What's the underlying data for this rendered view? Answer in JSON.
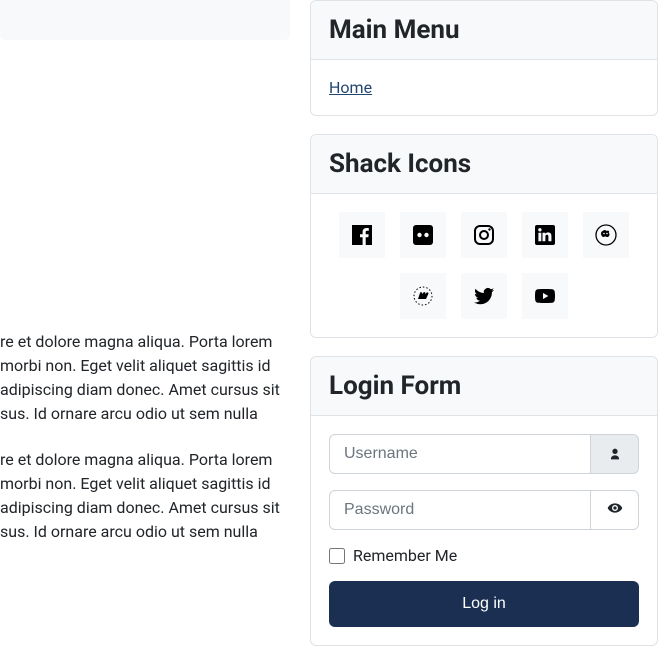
{
  "article": {
    "p1": "re et dolore magna aliqua. Porta lorem morbi non. Eget velit aliquet sagittis id adipiscing diam donec. Amet cursus sit sus. Id ornare arcu odio ut sem nulla",
    "p2": "re et dolore magna aliqua. Porta lorem morbi non. Eget velit aliquet sagittis id adipiscing diam donec. Amet cursus sit sus. Id ornare arcu odio ut sem nulla"
  },
  "main_menu": {
    "title": "Main Menu",
    "items": [
      {
        "label": "Home"
      }
    ]
  },
  "shack_icons": {
    "title": "Shack Icons"
  },
  "login_form": {
    "title": "Login Form",
    "username_placeholder": "Username",
    "password_placeholder": "Password",
    "remember_label": "Remember Me",
    "submit_label": "Log in"
  }
}
